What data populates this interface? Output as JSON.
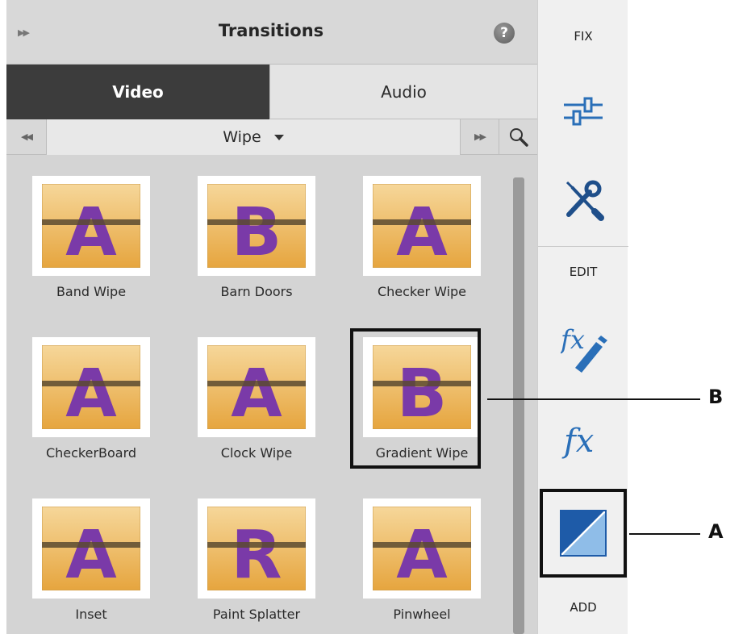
{
  "panel": {
    "title": "Transitions",
    "collapse_icon": "double-chevron-right-icon",
    "help_icon": "help-icon",
    "help_symbol": "?",
    "tabs": [
      {
        "label": "Video",
        "active": true
      },
      {
        "label": "Audio",
        "active": false
      }
    ],
    "category_nav": {
      "prev_icon": "double-chevron-left-icon",
      "next_icon": "double-chevron-right-icon",
      "selected": "Wipe",
      "search_icon": "search-icon"
    },
    "transitions": [
      {
        "label": "Band Wipe",
        "glyph": "A"
      },
      {
        "label": "Barn Doors",
        "glyph": "B"
      },
      {
        "label": "Checker Wipe",
        "glyph": "A"
      },
      {
        "label": "CheckerBoard",
        "glyph": "A"
      },
      {
        "label": "Clock Wipe",
        "glyph": "A"
      },
      {
        "label": "Gradient Wipe",
        "glyph": "B",
        "selected": true
      },
      {
        "label": "Inset",
        "glyph": "A"
      },
      {
        "label": "Paint Splatter",
        "glyph": "R"
      },
      {
        "label": "Pinwheel",
        "glyph": "A"
      }
    ]
  },
  "toolbar": {
    "fix_label": "FIX",
    "edit_label": "EDIT",
    "add_label": "ADD",
    "tools": [
      {
        "name": "adjustments-sliders-icon"
      },
      {
        "name": "tools-wrench-screwdriver-icon"
      },
      {
        "name": "applied-effects-fx-pencil-icon"
      },
      {
        "name": "effects-fx-icon"
      },
      {
        "name": "transitions-icon",
        "highlighted": true
      }
    ]
  },
  "callouts": [
    {
      "letter": "B"
    },
    {
      "letter": "A"
    }
  ],
  "colors": {
    "thumb_top": "#f6d79a",
    "thumb_bottom": "#e6a53e",
    "glyph": "#7a3aa8",
    "band": "#5b4a30",
    "accent_blue": "#2a6fb8"
  }
}
